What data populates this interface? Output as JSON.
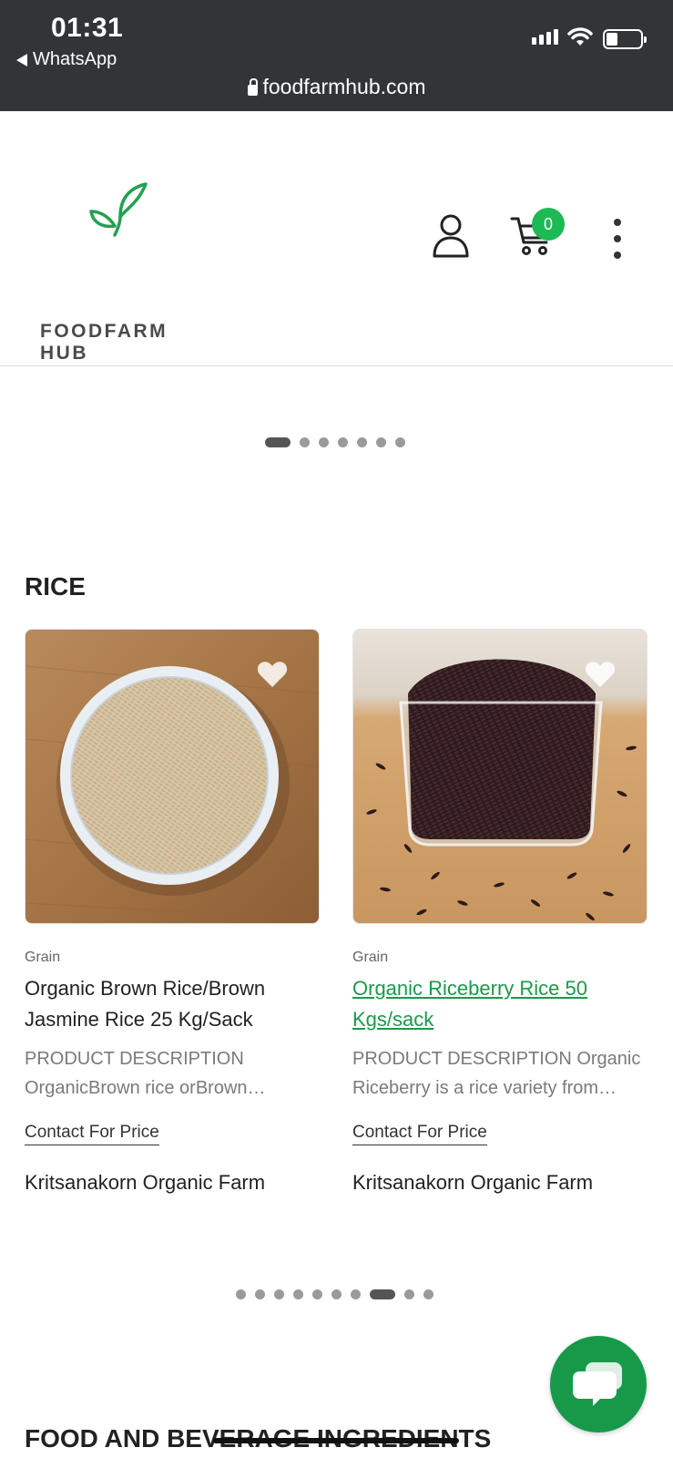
{
  "status_bar": {
    "time": "01:31",
    "back_app": "WhatsApp",
    "url": "foodfarmhub.com"
  },
  "header": {
    "logo_text": "FOODFARM HUB",
    "cart_count": "0",
    "brand_color": "#1a9a48"
  },
  "hero_carousel": {
    "dot_count": 7,
    "active_index": 0
  },
  "rice_section": {
    "title": "RICE",
    "products": [
      {
        "category": "Grain",
        "name": "Organic Brown Rice/Brown Jasmine Rice 25 Kg/Sack",
        "description": "PRODUCT DESCRIPTION OrganicBrown rice orBrown…",
        "price": "Contact For Price",
        "seller": "Kritsanakorn Organic Farm",
        "image": "brown-rice-bowl"
      },
      {
        "category": "Grain",
        "name": "Organic Riceberry Rice 50 Kgs/sack",
        "description": "PRODUCT DESCRIPTION Organic Riceberry is a rice variety from…",
        "price": "Contact For Price",
        "seller": "Kritsanakorn Organic Farm",
        "image": "riceberry-glass"
      }
    ],
    "carousel": {
      "dot_count": 10,
      "active_index": 7
    }
  },
  "next_section": {
    "title": "FOOD AND BEVERAGE INGREDIENTS"
  }
}
